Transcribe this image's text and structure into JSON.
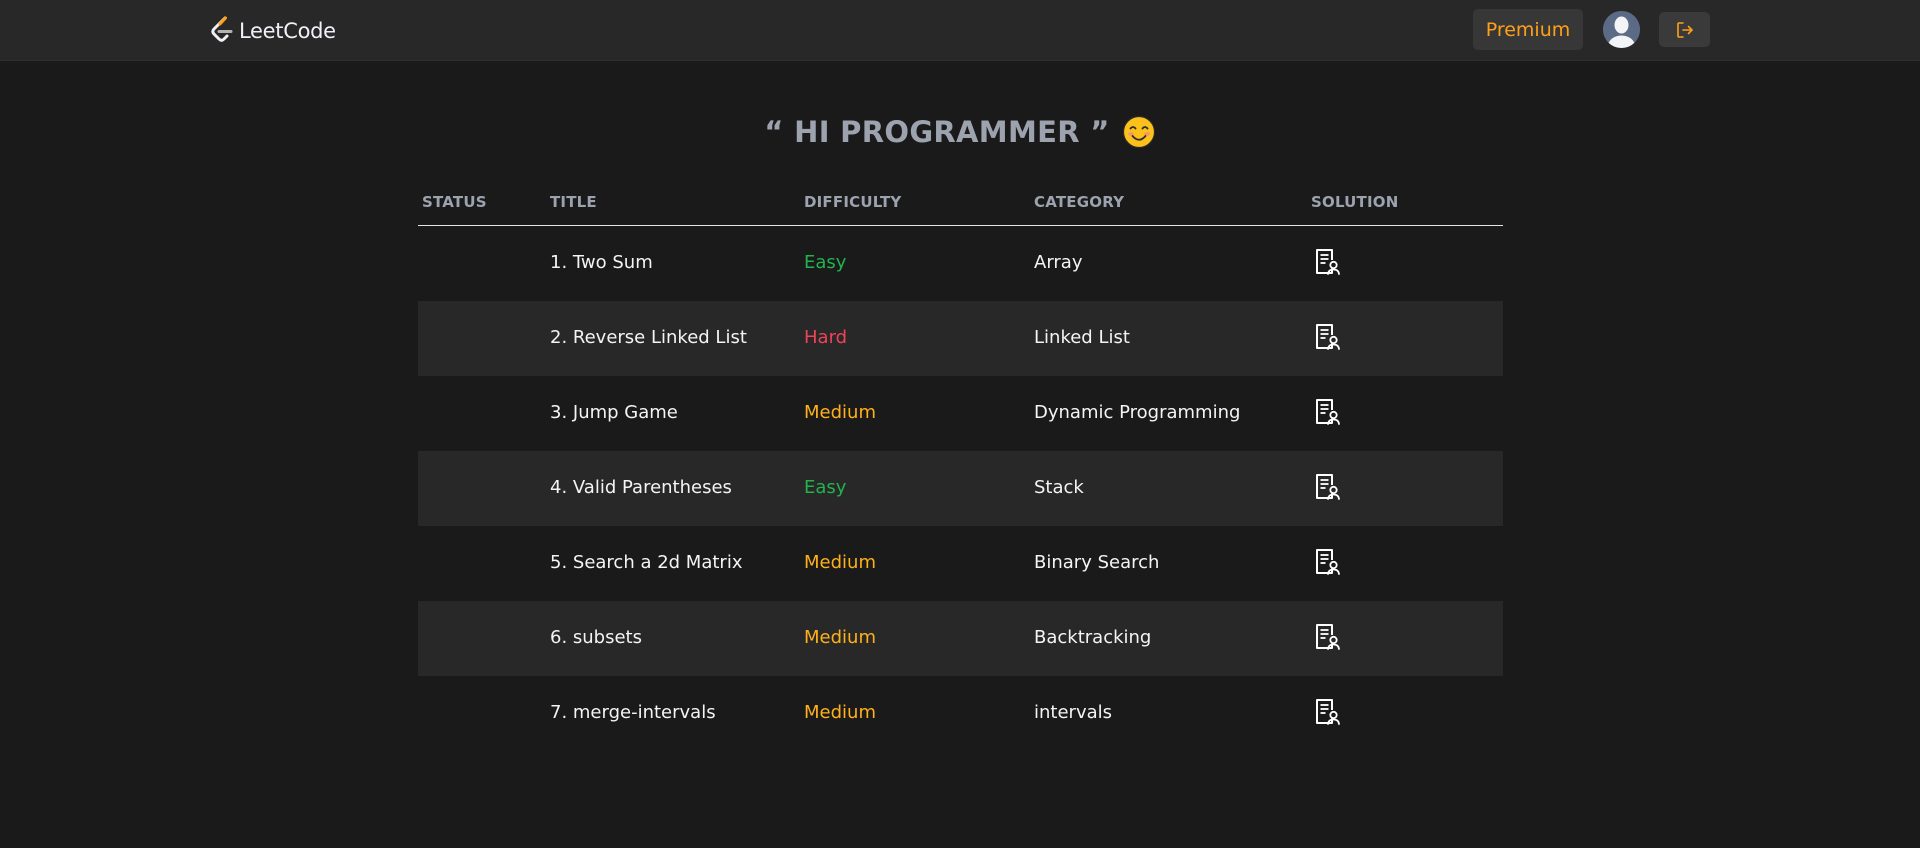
{
  "navbar": {
    "logo_text": "LeetCode",
    "premium_label": "Premium",
    "accent_color": "#ffa116"
  },
  "greeting": {
    "text": "“ HI PROGRAMMER ”",
    "emoji": "smiling-face-emoji"
  },
  "table": {
    "headers": {
      "status": "STATUS",
      "title": "TITLE",
      "difficulty": "DIFFICULTY",
      "category": "CATEGORY",
      "solution": "SOLUTION"
    },
    "rows": [
      {
        "status": "",
        "title": "1. Two Sum",
        "difficulty": "Easy",
        "category": "Array",
        "solution_icon": "solution-document-icon"
      },
      {
        "status": "",
        "title": "2. Reverse Linked List",
        "difficulty": "Hard",
        "category": "Linked List",
        "solution_icon": "solution-document-icon"
      },
      {
        "status": "",
        "title": "3. Jump Game",
        "difficulty": "Medium",
        "category": "Dynamic Programming",
        "solution_icon": "solution-document-icon"
      },
      {
        "status": "",
        "title": "4. Valid Parentheses",
        "difficulty": "Easy",
        "category": "Stack",
        "solution_icon": "solution-document-icon"
      },
      {
        "status": "",
        "title": "5. Search a 2d Matrix",
        "difficulty": "Medium",
        "category": "Binary Search",
        "solution_icon": "solution-document-icon"
      },
      {
        "status": "",
        "title": "6. subsets",
        "difficulty": "Medium",
        "category": "Backtracking",
        "solution_icon": "solution-document-icon"
      },
      {
        "status": "",
        "title": "7. merge-intervals",
        "difficulty": "Medium",
        "category": "intervals",
        "solution_icon": "solution-document-icon"
      }
    ]
  },
  "colors": {
    "easy": "#22b34c",
    "medium": "#ffb01b",
    "hard": "#ef4358"
  }
}
